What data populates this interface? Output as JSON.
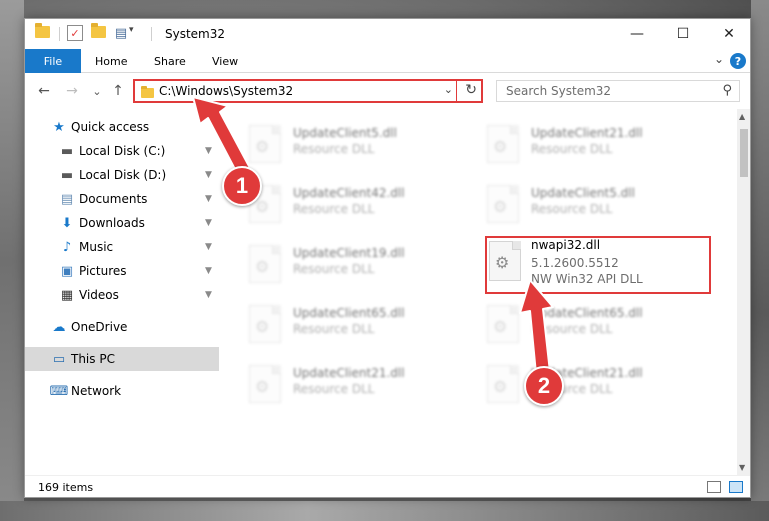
{
  "window": {
    "title": "System32",
    "qat_dropdown": "▾",
    "controls": {
      "minimize": "—",
      "maximize": "☐",
      "close": "✕"
    }
  },
  "ribbon": {
    "file": "File",
    "tabs": [
      "Home",
      "Share",
      "View"
    ],
    "help": "?",
    "collapse": "⌄"
  },
  "nav": {
    "back": "←",
    "forward": "→",
    "recent": "⌄",
    "up": "↑",
    "address": "C:\\Windows\\System32",
    "address_dropdown": "⌄",
    "refresh": "↻",
    "search_placeholder": "Search System32",
    "search_icon": "⚲"
  },
  "sidebar": {
    "items": [
      {
        "label": "Quick access",
        "icon": "star-icon",
        "glyph": "★",
        "color": "#1979ca",
        "pinned": false
      },
      {
        "label": "Local Disk (C:)",
        "icon": "drive-icon",
        "glyph": "▬",
        "color": "#5a5a5a",
        "pinned": true
      },
      {
        "label": "Local Disk (D:)",
        "icon": "drive-icon",
        "glyph": "▬",
        "color": "#5a5a5a",
        "pinned": true
      },
      {
        "label": "Documents",
        "icon": "documents-icon",
        "glyph": "▤",
        "color": "#6a8fb5",
        "pinned": true
      },
      {
        "label": "Downloads",
        "icon": "downloads-icon",
        "glyph": "⬇",
        "color": "#1979ca",
        "pinned": true
      },
      {
        "label": "Music",
        "icon": "music-icon",
        "glyph": "♪",
        "color": "#1979ca",
        "pinned": true
      },
      {
        "label": "Pictures",
        "icon": "pictures-icon",
        "glyph": "▣",
        "color": "#3f7fbf",
        "pinned": true
      },
      {
        "label": "Videos",
        "icon": "videos-icon",
        "glyph": "▦",
        "color": "#333333",
        "pinned": true
      },
      {
        "label": "OneDrive",
        "icon": "onedrive-icon",
        "glyph": "☁",
        "color": "#1979ca",
        "pinned": false
      },
      {
        "label": "This PC",
        "icon": "computer-icon",
        "glyph": "▭",
        "color": "#2a6fb0",
        "pinned": false
      },
      {
        "label": "Network",
        "icon": "network-icon",
        "glyph": "⌨",
        "color": "#2a6fb0",
        "pinned": false
      }
    ],
    "pin_glyph": "📌"
  },
  "files": [
    {
      "name": "UpdateClient5.dll",
      "type": "Resource DLL"
    },
    {
      "name": "UpdateClient21.dll",
      "type": "Resource DLL"
    },
    {
      "name": "UpdateClient42.dll",
      "type": "Resource DLL"
    },
    {
      "name": "UpdateClient5.dll",
      "type": "Resource DLL"
    },
    {
      "name": "UpdateClient19.dll",
      "type": "Resource DLL"
    },
    {
      "name": "UpdateClient65.dll",
      "type": "Resource DLL"
    },
    {
      "name": "UpdateClient65.dll",
      "type": "Resource DLL"
    },
    {
      "name": "UpdateClient21.dll",
      "type": "Resource DLL"
    },
    {
      "name": "UpdateClient21.dll",
      "type": "Resource DLL"
    }
  ],
  "highlighted_file": {
    "name": "nwapi32.dll",
    "version": "5.1.2600.5512",
    "description": "NW Win32 API DLL"
  },
  "status": {
    "item_count": "169 items"
  },
  "annotations": {
    "step1": "1",
    "step2": "2",
    "color": "#e03a3a"
  }
}
